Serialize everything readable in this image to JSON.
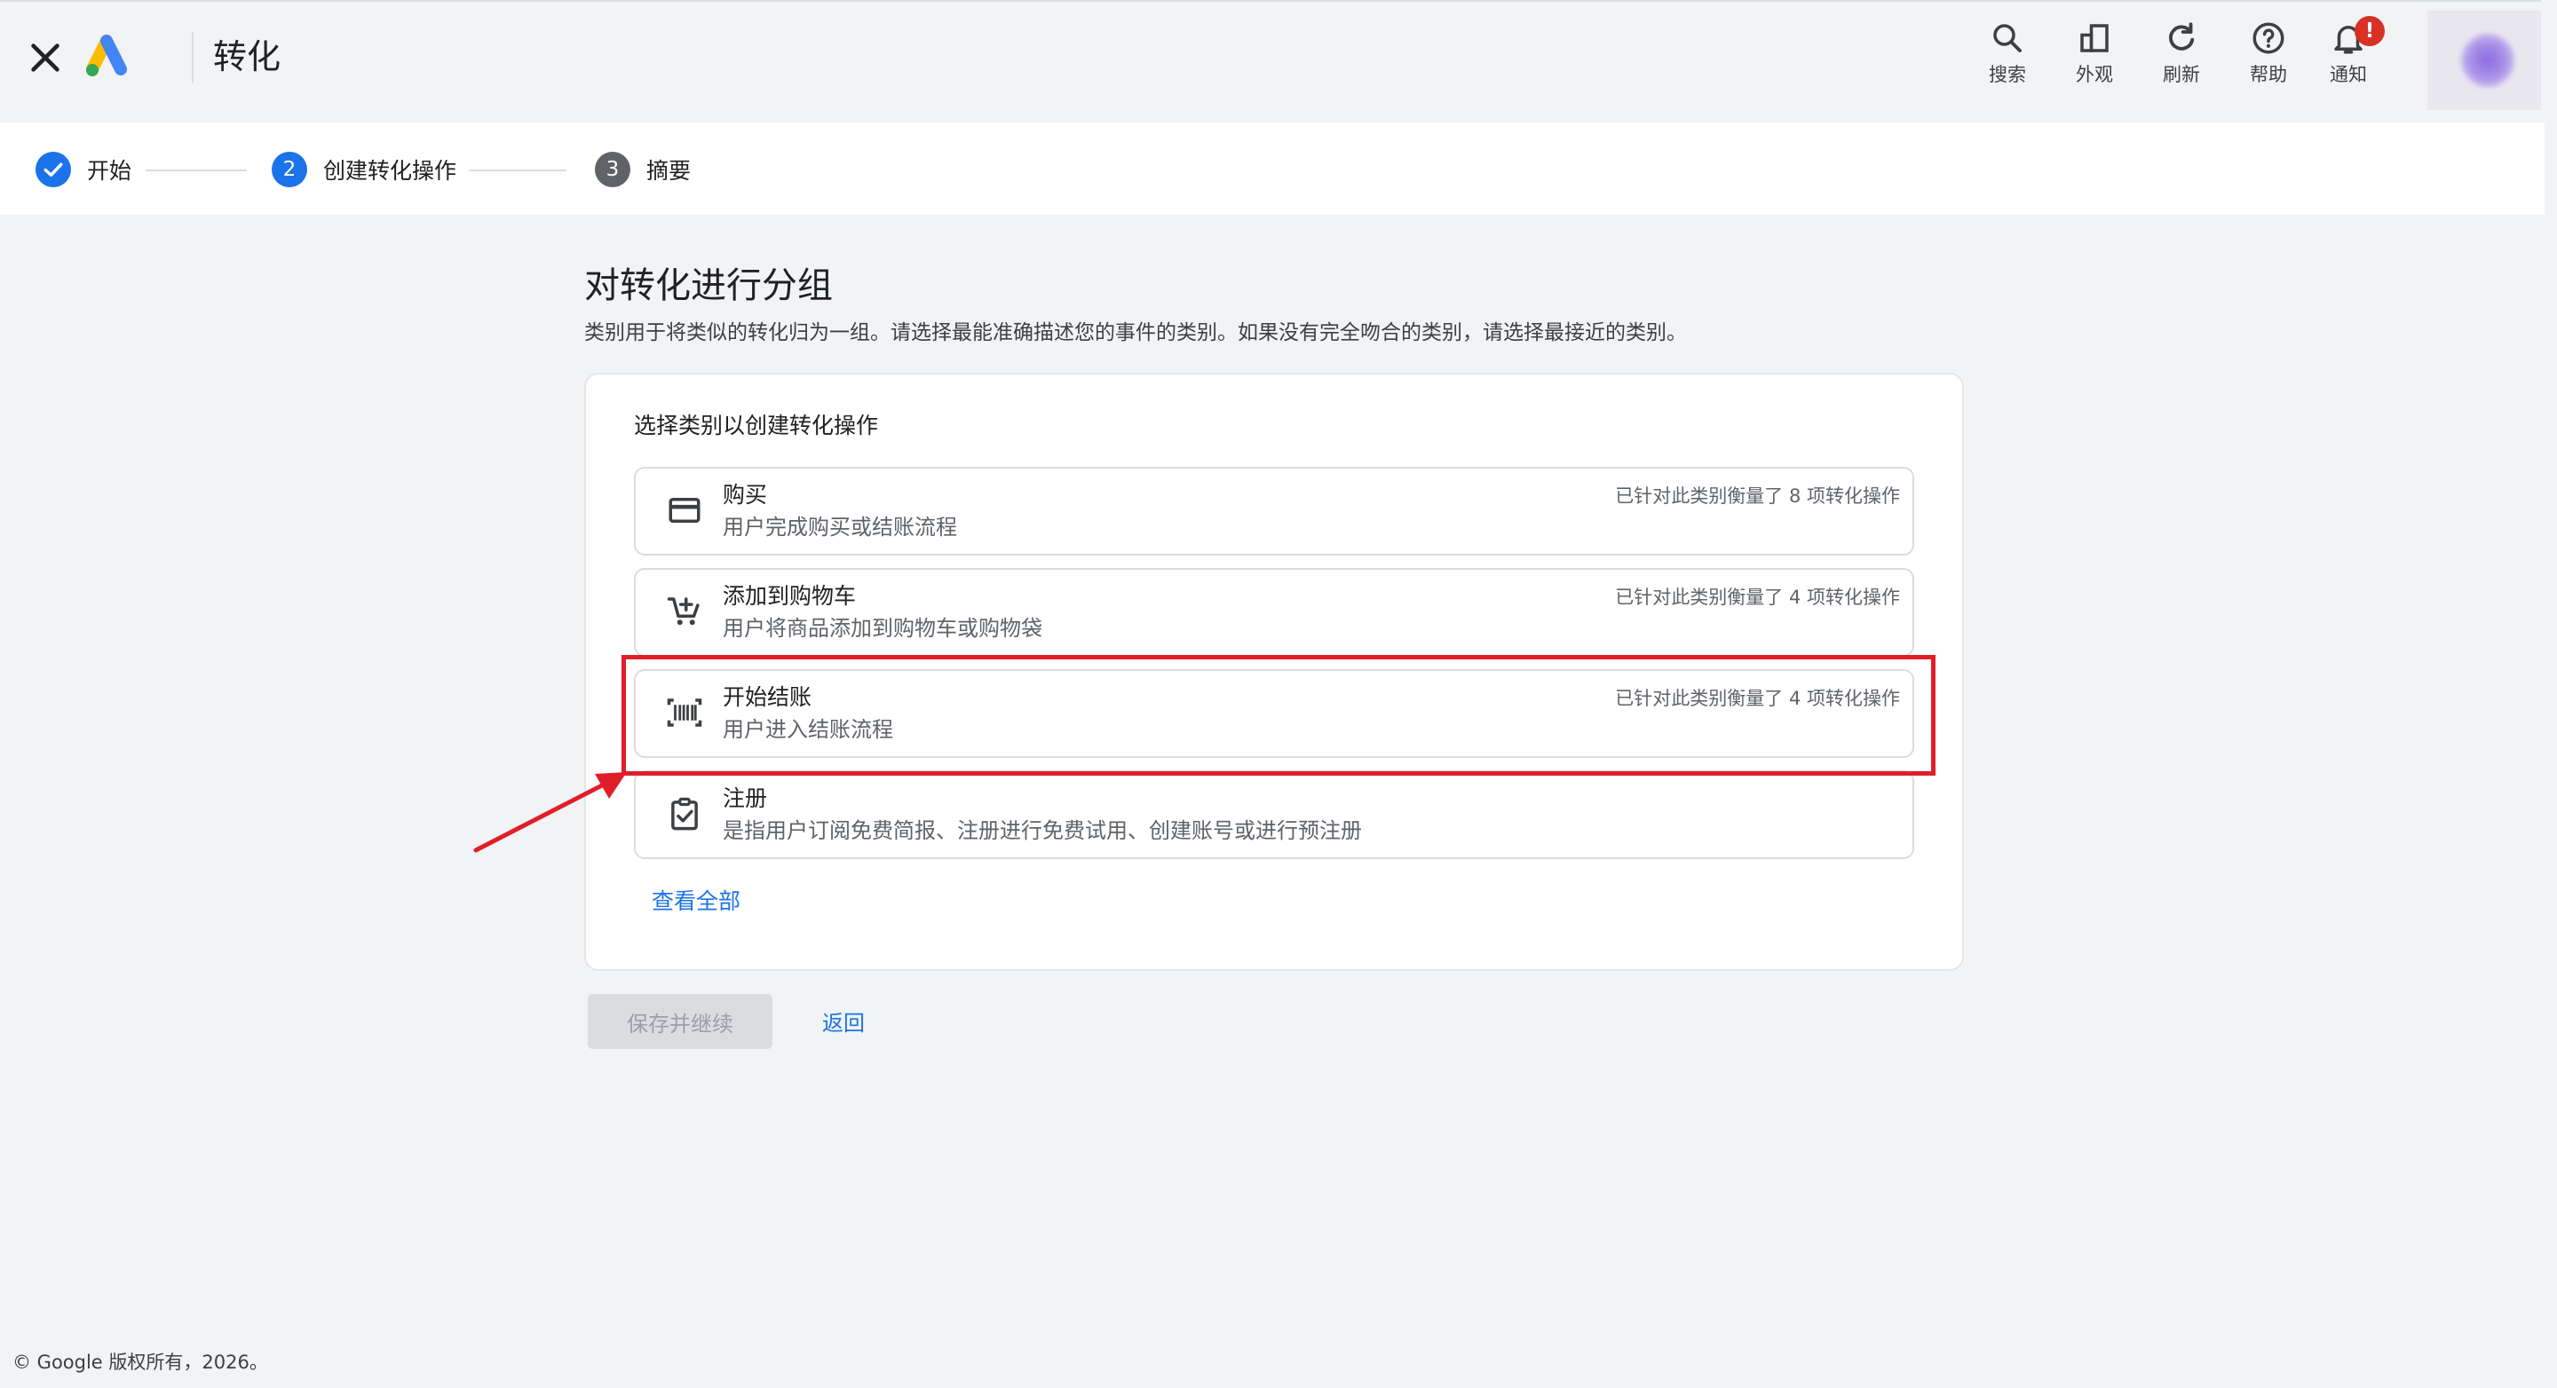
{
  "header": {
    "title": "转化",
    "close_icon": "close-icon",
    "logo": "google-ads-logo",
    "tools": [
      {
        "label": "搜索",
        "icon": "search-icon"
      },
      {
        "label": "外观",
        "icon": "appearance-icon"
      },
      {
        "label": "刷新",
        "icon": "refresh-icon"
      },
      {
        "label": "帮助",
        "icon": "help-icon"
      },
      {
        "label": "通知",
        "icon": "bell-icon",
        "badge": "!"
      }
    ]
  },
  "stepper": {
    "steps": [
      {
        "label": "开始",
        "state": "done",
        "number": "✓"
      },
      {
        "label": "创建转化操作",
        "state": "active",
        "number": "2"
      },
      {
        "label": "摘要",
        "state": "pending",
        "number": "3"
      }
    ]
  },
  "main": {
    "heading": "对转化进行分组",
    "subtext": "类别用于将类似的转化归为一组。请选择最能准确描述您的事件的类别。如果没有完全吻合的类别，请选择最接近的类别。",
    "card_title": "选择类别以创建转化操作",
    "options": [
      {
        "title": "购买",
        "desc": "用户完成购买或结账流程",
        "count": "已针对此类别衡量了 8 项转化操作",
        "icon": "credit-card-icon"
      },
      {
        "title": "添加到购物车",
        "desc": "用户将商品添加到购物车或购物袋",
        "count": "已针对此类别衡量了 4 项转化操作",
        "icon": "add-to-cart-icon"
      },
      {
        "title": "开始结账",
        "desc": "用户进入结账流程",
        "count": "已针对此类别衡量了 4 项转化操作",
        "icon": "barcode-scanner-icon"
      },
      {
        "title": "注册",
        "desc": "是指用户订阅免费简报、注册进行免费试用、创建账号或进行预注册",
        "count": "",
        "icon": "clipboard-check-icon"
      }
    ],
    "view_all": "查看全部"
  },
  "actions": {
    "save_label": "保存并继续",
    "back_label": "返回"
  },
  "footer": {
    "copyright": "© Google 版权所有，2026。"
  },
  "colors": {
    "accent": "#1a73e8",
    "highlight": "#e01e2a",
    "badge": "#d93025",
    "background": "#f1f3f4"
  }
}
